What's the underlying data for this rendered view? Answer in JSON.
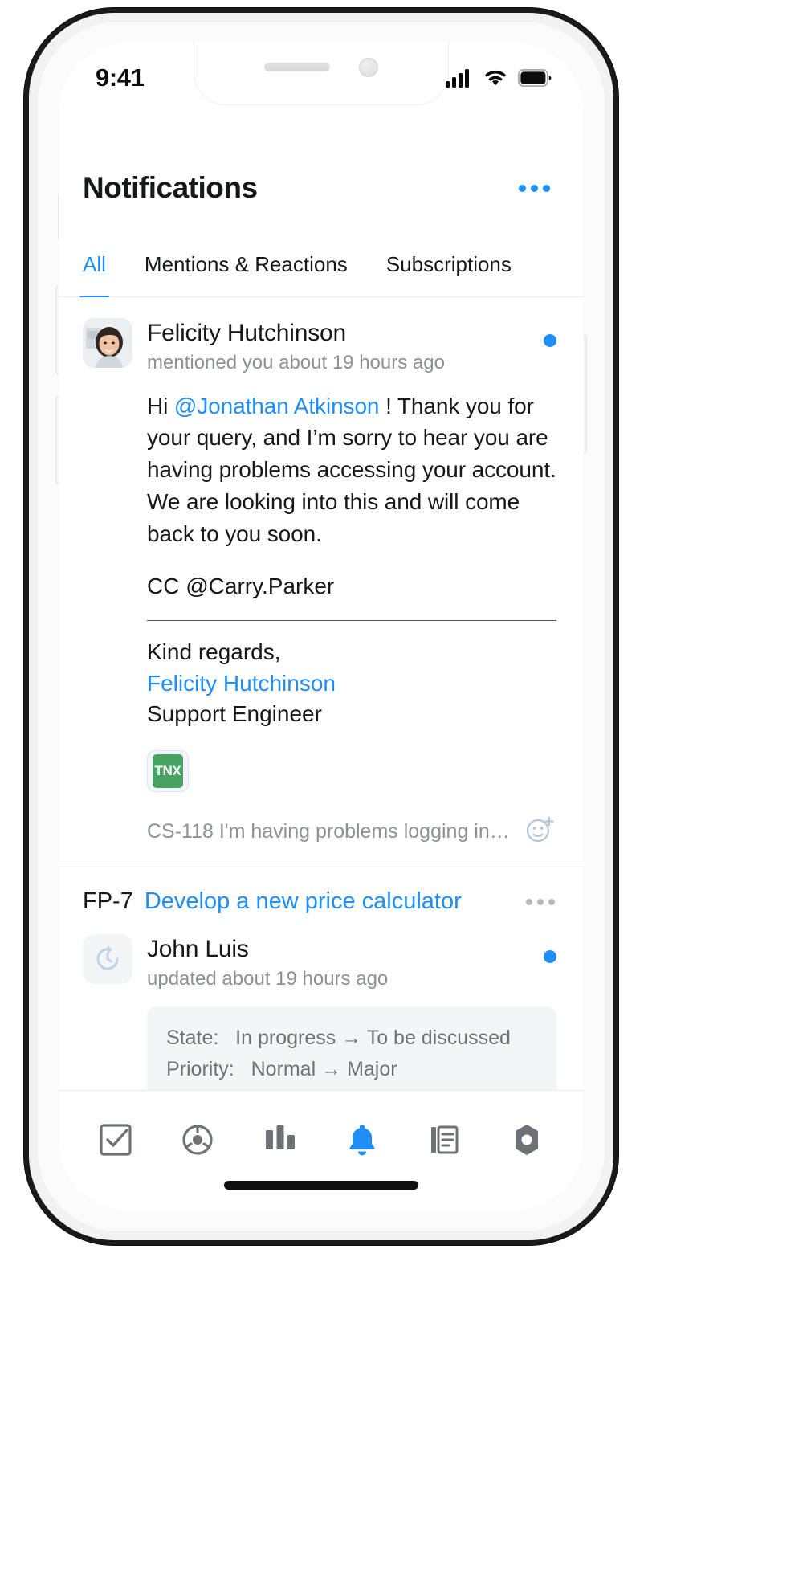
{
  "status_bar": {
    "time": "9:41",
    "icons": [
      "cellular-signal-icon",
      "wifi-icon",
      "battery-icon"
    ]
  },
  "header": {
    "title": "Notifications",
    "more_icon": "more-horizontal-icon"
  },
  "tabs": [
    {
      "label": "All",
      "active": true
    },
    {
      "label": "Mentions & Reactions",
      "active": false
    },
    {
      "label": "Subscriptions",
      "active": false
    }
  ],
  "notifications": [
    {
      "id": "mention-card",
      "avatar_icon": "user-avatar-photo",
      "name": "Felicity Hutchinson",
      "meta": "mentioned you about 19 hours ago",
      "unread": true,
      "body_prefix": "Hi ",
      "mention": "@Jonathan Atkinson",
      "body_rest": " ! Thank you for your query, and I’m sorry to hear you are having problems accessing your account. We are looking into this and will come back to you soon.",
      "cc": "CC @Carry.Parker",
      "signature": [
        {
          "text": "Kind regards,",
          "link": false
        },
        {
          "text": "Felicity Hutchinson",
          "link": true
        },
        {
          "text": "Support Engineer",
          "link": false
        }
      ],
      "attachment": {
        "label": "TNX",
        "icon": "file-attachment-icon"
      },
      "footer_text": "CS-118 I'm having problems logging into...",
      "footer_icon": "add-reaction-icon"
    },
    {
      "id": "update-card",
      "issue_key": "FP-7",
      "issue_title": "Develop a new price calculator",
      "more_icon": "more-horizontal-icon",
      "avatar_icon": "update-history-icon",
      "name": "John Luis",
      "meta": "updated about 19 hours ago",
      "unread": true,
      "changes": [
        {
          "field": "State:",
          "from": "In progress",
          "arrow": "→",
          "to": "To be discussed"
        },
        {
          "field": "Priority:",
          "from": "Normal",
          "arrow": "→",
          "to": "Major"
        }
      ]
    }
  ],
  "bottom_nav": [
    {
      "name": "tasks",
      "icon": "checkbox-tasks-icon",
      "active": false
    },
    {
      "name": "agile",
      "icon": "agile-board-icon",
      "active": false
    },
    {
      "name": "boards",
      "icon": "kanban-board-icon",
      "active": false
    },
    {
      "name": "notifications",
      "icon": "bell-icon",
      "active": true
    },
    {
      "name": "knowledge-base",
      "icon": "article-list-icon",
      "active": false
    },
    {
      "name": "settings",
      "icon": "gear-settings-icon",
      "active": false
    }
  ],
  "colors": {
    "accent": "#1f8ef7",
    "text": "#17181a",
    "muted": "#8d9095",
    "attachment_green": "#48a363",
    "divider": "#ececee"
  }
}
